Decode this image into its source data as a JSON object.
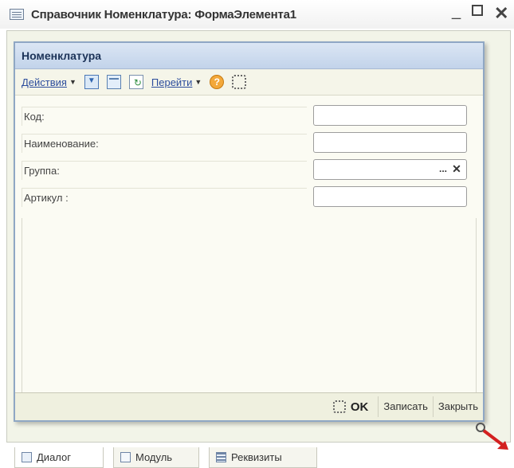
{
  "window": {
    "title": "Справочник Номенклатура: ФормаЭлемента1",
    "minimize": "_",
    "close": "✕"
  },
  "form": {
    "header": "Номенклатура",
    "toolbar": {
      "actions": "Действия",
      "goto": "Перейти",
      "help": "?",
      "icons": [
        "download-icon",
        "window-icon",
        "refresh-document-icon",
        "help-icon",
        "frame-icon"
      ]
    },
    "fields": [
      {
        "label": "Код:",
        "value": ""
      },
      {
        "label": "Наименование:",
        "value": ""
      },
      {
        "label": "Группа:",
        "value": "",
        "pick": "...",
        "clear": "✕"
      },
      {
        "label": "Артикул :",
        "value": ""
      }
    ],
    "footer": {
      "ok": "OK",
      "save": "Записать",
      "close": "Закрыть"
    }
  },
  "tabs": [
    {
      "label": "Диалог",
      "active": true
    },
    {
      "label": "Модуль",
      "active": false
    },
    {
      "label": "Реквизиты",
      "active": false
    }
  ],
  "colors": {
    "header_bg": "#c2d3ea",
    "link": "#2c4d9c",
    "resize_arrow": "#d32020"
  }
}
